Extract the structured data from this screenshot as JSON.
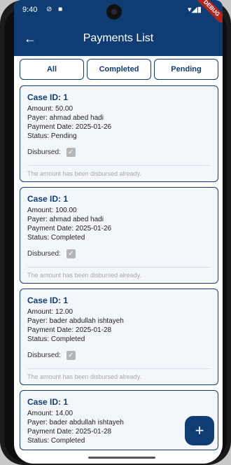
{
  "status": {
    "time": "9:40",
    "left_icons": "⊘ ■",
    "right_icons": "▾◢▮",
    "debug_banner": "DEBUG"
  },
  "appbar": {
    "title": "Payments List",
    "back_icon": "arrow-back-icon"
  },
  "filters": [
    {
      "label": "All"
    },
    {
      "label": "Completed"
    },
    {
      "label": "Pending"
    }
  ],
  "payments": [
    {
      "case_id": "Case ID: 1",
      "amount": "Amount: 50.00",
      "payer": "Payer: ahmad abed hadi",
      "date": "Payment Date: 2025-01-26",
      "status": "Status: Pending",
      "disbursed_label": "Disbursed:",
      "disbursed": true,
      "note": "The amount has been disbursed already."
    },
    {
      "case_id": "Case ID: 1",
      "amount": "Amount: 100.00",
      "payer": "Payer: ahmad abed hadi",
      "date": "Payment Date: 2025-01-26",
      "status": "Status: Completed",
      "disbursed_label": "Disbursed:",
      "disbursed": true,
      "note": "The amount has been disbursed already."
    },
    {
      "case_id": "Case ID: 1",
      "amount": "Amount: 12.00",
      "payer": "Payer: bader abdullah ishtayeh",
      "date": "Payment Date: 2025-01-28",
      "status": "Status: Completed",
      "disbursed_label": "Disbursed:",
      "disbursed": true,
      "note": "The amount has been disbursed already."
    },
    {
      "case_id": "Case ID: 1",
      "amount": "Amount: 14.00",
      "payer": "Payer: bader abdullah ishtayeh",
      "date": "Payment Date: 2025-01-28",
      "status": "Status: Completed"
    }
  ],
  "fab": {
    "label": "+",
    "icon": "add-icon"
  },
  "colors": {
    "primary": "#0f3d73",
    "card_bg": "#f3f6fb",
    "note": "#a8a8a8"
  }
}
